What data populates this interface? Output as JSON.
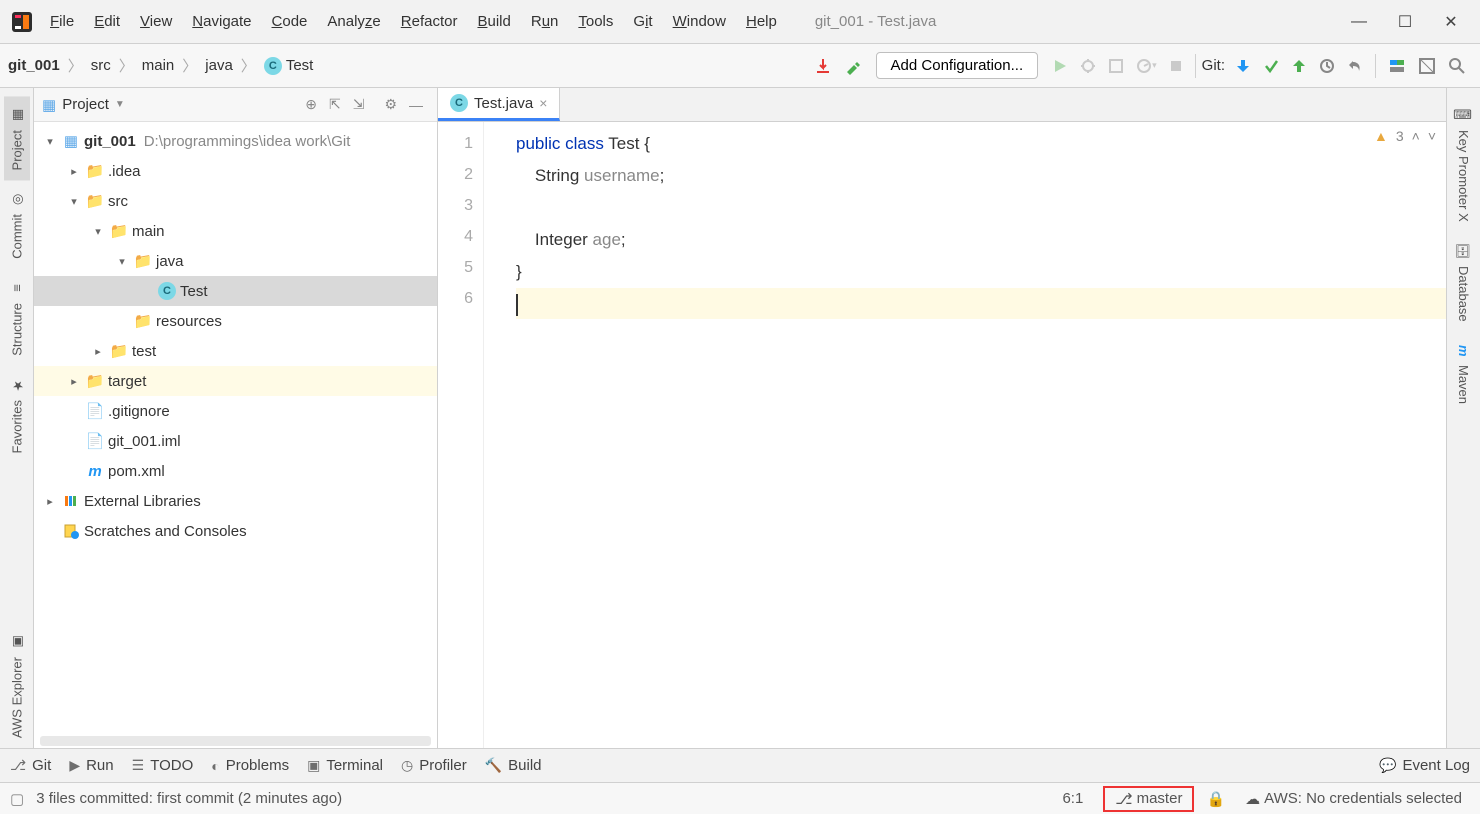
{
  "window_title": "git_001 - Test.java",
  "menus": [
    "File",
    "Edit",
    "View",
    "Navigate",
    "Code",
    "Analyze",
    "Refactor",
    "Build",
    "Run",
    "Tools",
    "Git",
    "Window",
    "Help"
  ],
  "breadcrumb": {
    "project": "git_001",
    "parts": [
      "src",
      "main",
      "java"
    ],
    "class": "Test"
  },
  "toolbar": {
    "add_config": "Add Configuration...",
    "git_label": "Git:"
  },
  "left_tabs": [
    "Project",
    "Commit",
    "Structure",
    "Favorites",
    "AWS Explorer"
  ],
  "right_tabs": [
    "Key Promoter X",
    "Database",
    "Maven"
  ],
  "project_panel": {
    "title": "Project",
    "tree": {
      "root": {
        "name": "git_001",
        "path": "D:\\programmings\\idea work\\Git"
      },
      "items": [
        {
          "indent": 1,
          "arrow": ">",
          "icon": "folder-gray",
          "label": ".idea"
        },
        {
          "indent": 1,
          "arrow": "v",
          "icon": "folder-gray",
          "label": "src"
        },
        {
          "indent": 2,
          "arrow": "v",
          "icon": "folder-gray",
          "label": "main"
        },
        {
          "indent": 3,
          "arrow": "v",
          "icon": "folder-blue",
          "label": "java"
        },
        {
          "indent": 4,
          "arrow": "",
          "icon": "class",
          "label": "Test",
          "selected": true
        },
        {
          "indent": 3,
          "arrow": "",
          "icon": "folder-gray",
          "label": "resources"
        },
        {
          "indent": 2,
          "arrow": ">",
          "icon": "folder-gray",
          "label": "test"
        },
        {
          "indent": 1,
          "arrow": ">",
          "icon": "folder-orange",
          "label": "target",
          "highlight": true
        },
        {
          "indent": 1,
          "arrow": "",
          "icon": "file-gray",
          "label": ".gitignore"
        },
        {
          "indent": 1,
          "arrow": "",
          "icon": "file-gray",
          "label": "git_001.iml"
        },
        {
          "indent": 1,
          "arrow": "",
          "icon": "maven",
          "label": "pom.xml"
        }
      ],
      "external": "External Libraries",
      "scratches": "Scratches and Consoles"
    }
  },
  "editor": {
    "tab_name": "Test.java",
    "warning_count": "3",
    "lines": [
      {
        "n": "1",
        "html": "<span class='kw'>public class</span> Test {"
      },
      {
        "n": "2",
        "html": "    String <span class='ident'>username</span>;"
      },
      {
        "n": "3",
        "html": ""
      },
      {
        "n": "4",
        "html": "    Integer <span class='ident'>age</span>;"
      },
      {
        "n": "5",
        "html": "}"
      },
      {
        "n": "6",
        "html": "<span class='caret'></span>",
        "current": true
      }
    ]
  },
  "bottom_tools": {
    "git": "Git",
    "run": "Run",
    "todo": "TODO",
    "problems": "Problems",
    "terminal": "Terminal",
    "profiler": "Profiler",
    "build": "Build",
    "event_log": "Event Log"
  },
  "status": {
    "message": "3 files committed: first commit (2 minutes ago)",
    "pos": "6:1",
    "branch": "master",
    "aws": "AWS: No credentials selected"
  }
}
